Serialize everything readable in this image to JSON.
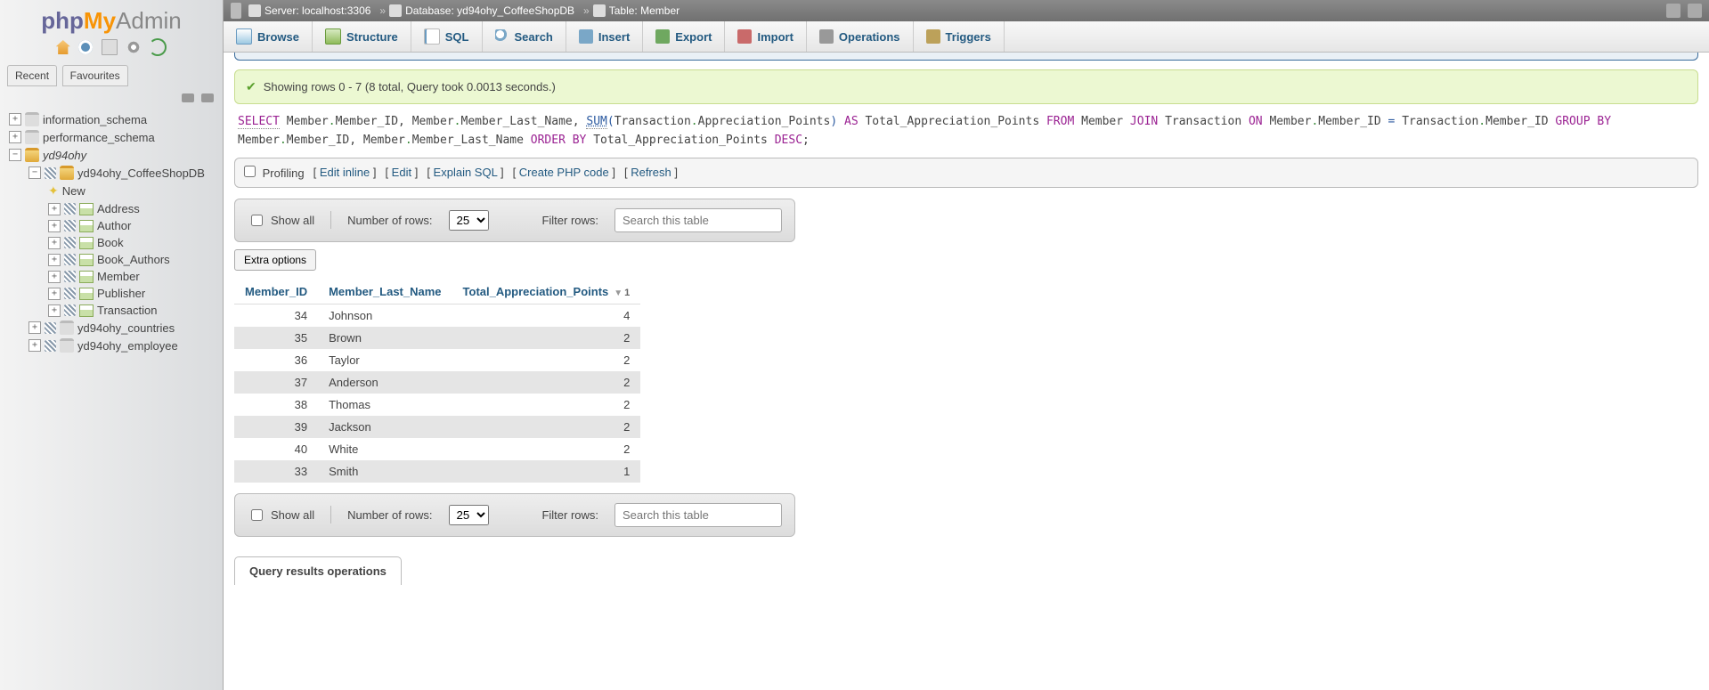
{
  "logo": {
    "p1": "php",
    "p2": "My",
    "p3": "Admin"
  },
  "nav_quick_icons": [
    "home",
    "logout",
    "docs",
    "settings",
    "reload"
  ],
  "recent_fav": {
    "recent": "Recent",
    "favourites": "Favourites"
  },
  "tree": [
    {
      "depth": 0,
      "expand": "plus",
      "icon": "db-generic",
      "label": "information_schema"
    },
    {
      "depth": 0,
      "expand": "plus",
      "icon": "db-generic",
      "label": "performance_schema"
    },
    {
      "depth": 0,
      "expand": "minus",
      "icon": "db",
      "label": "yd94ohy",
      "italic": true
    },
    {
      "depth": 1,
      "expand": "minus",
      "icon": "db",
      "label": "yd94ohy_CoffeeShopDB"
    },
    {
      "depth": 2,
      "expand": "none",
      "icon": "new",
      "label": "New"
    },
    {
      "depth": 2,
      "expand": "plus",
      "icon": "tbl",
      "label": "Address"
    },
    {
      "depth": 2,
      "expand": "plus",
      "icon": "tbl",
      "label": "Author"
    },
    {
      "depth": 2,
      "expand": "plus",
      "icon": "tbl",
      "label": "Book"
    },
    {
      "depth": 2,
      "expand": "plus",
      "icon": "tbl",
      "label": "Book_Authors"
    },
    {
      "depth": 2,
      "expand": "plus",
      "icon": "tbl",
      "label": "Member",
      "selected": true
    },
    {
      "depth": 2,
      "expand": "plus",
      "icon": "tbl",
      "label": "Publisher"
    },
    {
      "depth": 2,
      "expand": "plus",
      "icon": "tbl",
      "label": "Transaction"
    },
    {
      "depth": 1,
      "expand": "plus",
      "icon": "db-generic",
      "label": "yd94ohy_countries"
    },
    {
      "depth": 1,
      "expand": "plus",
      "icon": "db-generic",
      "label": "yd94ohy_employee"
    }
  ],
  "breadcrumb": {
    "server_lbl": "Server:",
    "server_val": "localhost:3306",
    "db_lbl": "Database:",
    "db_val": "yd94ohy_CoffeeShopDB",
    "tbl_lbl": "Table:",
    "tbl_val": "Member"
  },
  "tabs": [
    {
      "id": "browse",
      "label": "Browse"
    },
    {
      "id": "structure",
      "label": "Structure"
    },
    {
      "id": "sql",
      "label": "SQL"
    },
    {
      "id": "search",
      "label": "Search"
    },
    {
      "id": "insert",
      "label": "Insert"
    },
    {
      "id": "export",
      "label": "Export"
    },
    {
      "id": "import",
      "label": "Import"
    },
    {
      "id": "operations",
      "label": "Operations"
    },
    {
      "id": "triggers",
      "label": "Triggers"
    }
  ],
  "success_msg": "Showing rows 0 - 7 (8 total, Query took 0.0013 seconds.)",
  "sql_tokens": [
    {
      "t": "SELECT",
      "c": "kw underlined"
    },
    {
      "t": " Member",
      "c": "id"
    },
    {
      "t": ".",
      "c": "dot"
    },
    {
      "t": "Member_ID",
      "c": "id"
    },
    {
      "t": ", ",
      "c": ""
    },
    {
      "t": "Member",
      "c": "id"
    },
    {
      "t": ".",
      "c": "dot"
    },
    {
      "t": "Member_Last_Name",
      "c": "id"
    },
    {
      "t": ", ",
      "c": ""
    },
    {
      "t": "SUM",
      "c": "fn underlined"
    },
    {
      "t": "(",
      "c": "op"
    },
    {
      "t": "Transaction",
      "c": "id"
    },
    {
      "t": ".",
      "c": "dot"
    },
    {
      "t": "Appreciation_Points",
      "c": "id"
    },
    {
      "t": ")",
      "c": "op"
    },
    {
      "t": " AS ",
      "c": "kw"
    },
    {
      "t": "Total_Appreciation_Points ",
      "c": "id"
    },
    {
      "t": "FROM ",
      "c": "kw"
    },
    {
      "t": "Member ",
      "c": "id"
    },
    {
      "t": "JOIN ",
      "c": "kw"
    },
    {
      "t": "Transaction ",
      "c": "id"
    },
    {
      "t": "ON ",
      "c": "kw"
    },
    {
      "t": "Member",
      "c": "id"
    },
    {
      "t": ".",
      "c": "dot"
    },
    {
      "t": "Member_ID ",
      "c": "id"
    },
    {
      "t": "= ",
      "c": "op"
    },
    {
      "t": "Transaction",
      "c": "id"
    },
    {
      "t": ".",
      "c": "dot"
    },
    {
      "t": "Member_ID ",
      "c": "id"
    },
    {
      "t": "GROUP BY ",
      "c": "kw"
    },
    {
      "t": "Member",
      "c": "id"
    },
    {
      "t": ".",
      "c": "dot"
    },
    {
      "t": "Member_ID",
      "c": "id"
    },
    {
      "t": ", ",
      "c": ""
    },
    {
      "t": "Member",
      "c": "id"
    },
    {
      "t": ".",
      "c": "dot"
    },
    {
      "t": "Member_Last_Name ",
      "c": "id"
    },
    {
      "t": "ORDER BY ",
      "c": "kw"
    },
    {
      "t": "Total_Appreciation_Points ",
      "c": "id"
    },
    {
      "t": "DESC",
      "c": "kw"
    },
    {
      "t": ";",
      "c": ""
    }
  ],
  "tools": {
    "profiling": "Profiling",
    "edit_inline": "Edit inline",
    "edit": "Edit",
    "explain": "Explain SQL",
    "create_php": "Create PHP code",
    "refresh": "Refresh"
  },
  "controls": {
    "show_all": "Show all",
    "num_rows": "Number of rows:",
    "rows_value": "25",
    "filter_label": "Filter rows:",
    "filter_placeholder": "Search this table"
  },
  "extra_options": "Extra options",
  "columns": [
    {
      "key": "Member_ID",
      "label": "Member_ID",
      "align": "r"
    },
    {
      "key": "Member_Last_Name",
      "label": "Member_Last_Name",
      "align": "l"
    },
    {
      "key": "Total_Appreciation_Points",
      "label": "Total_Appreciation_Points",
      "align": "r",
      "sort": "desc",
      "sortnum": "1"
    }
  ],
  "rows": [
    {
      "Member_ID": "34",
      "Member_Last_Name": "Johnson",
      "Total_Appreciation_Points": "4"
    },
    {
      "Member_ID": "35",
      "Member_Last_Name": "Brown",
      "Total_Appreciation_Points": "2"
    },
    {
      "Member_ID": "36",
      "Member_Last_Name": "Taylor",
      "Total_Appreciation_Points": "2"
    },
    {
      "Member_ID": "37",
      "Member_Last_Name": "Anderson",
      "Total_Appreciation_Points": "2"
    },
    {
      "Member_ID": "38",
      "Member_Last_Name": "Thomas",
      "Total_Appreciation_Points": "2"
    },
    {
      "Member_ID": "39",
      "Member_Last_Name": "Jackson",
      "Total_Appreciation_Points": "2"
    },
    {
      "Member_ID": "40",
      "Member_Last_Name": "White",
      "Total_Appreciation_Points": "2"
    },
    {
      "Member_ID": "33",
      "Member_Last_Name": "Smith",
      "Total_Appreciation_Points": "1"
    }
  ],
  "query_ops": "Query results operations"
}
